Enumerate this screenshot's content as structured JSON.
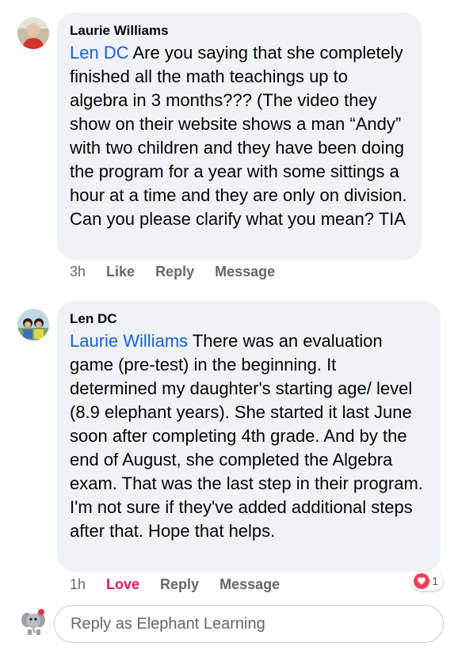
{
  "comments": [
    {
      "author": "Laurie Williams",
      "mention": "Len DC",
      "text": " Are you saying that she completely finished all the math teachings up to algebra in 3 months??? (The  video they show on their website shows a man “Andy” with two children and they have been doing the program for a year with some sittings a hour at a time and they are only on division. Can you please clarify what you mean? TIA",
      "time": "3h",
      "like_label": "Like",
      "reply_label": "Reply",
      "message_label": "Message"
    },
    {
      "author": "Len DC",
      "mention": "Laurie Williams",
      "text": " There was an evaluation game (pre-test) in the beginning. It determined my daughter's starting age/ level (8.9 elephant years). She  started it last June soon after completing 4th grade. And by the end of August, she completed the Algebra exam. That was the last step in their program. I'm not sure if they've added additional steps after that. Hope that helps.",
      "time": "1h",
      "like_label": "Love",
      "reply_label": "Reply",
      "message_label": "Message",
      "reaction_icon": "heart-icon",
      "reaction_count": "1"
    }
  ],
  "reply": {
    "placeholder": "Reply as Elephant Learning",
    "avatar_icon": "elephant-icon"
  },
  "colors": {
    "mention": "#1a5fd6",
    "love": "#e4185b",
    "bubble": "#f0f2f5",
    "meta": "#65676b"
  }
}
